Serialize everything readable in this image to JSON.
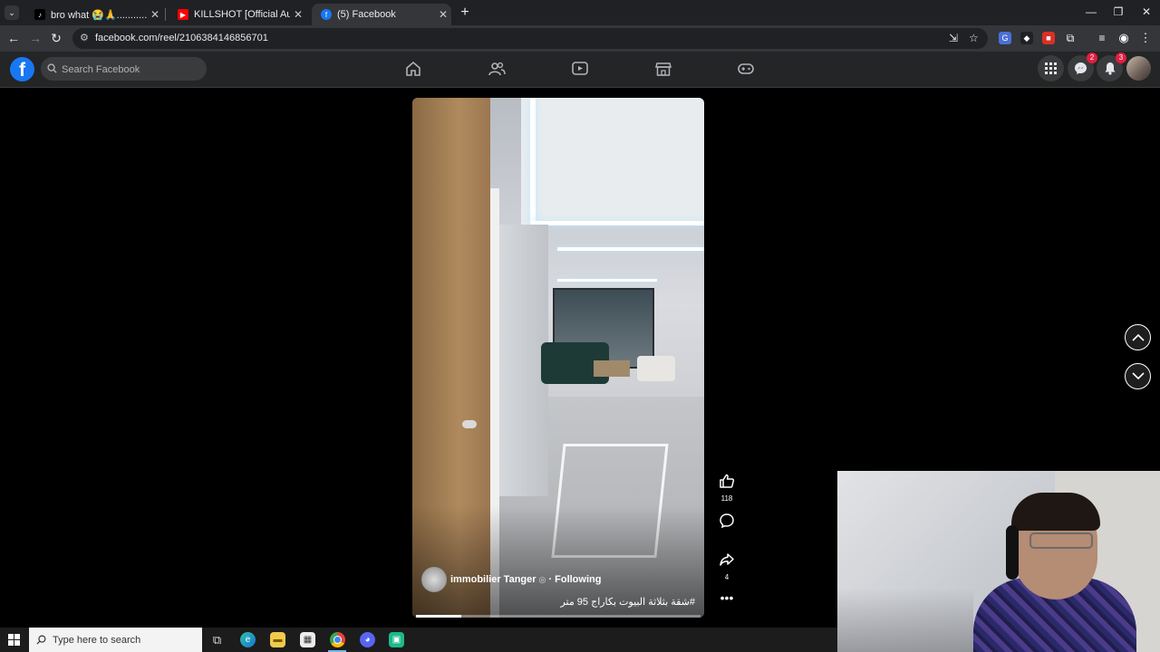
{
  "browser": {
    "tabs": [
      {
        "title": "bro what 😭🙏.....................#fy",
        "active": false,
        "favicon": "tiktok-icon"
      },
      {
        "title": "KILLSHOT [Official Audio] - You",
        "active": false,
        "favicon": "youtube-icon"
      },
      {
        "title": "(5) Facebook",
        "active": true,
        "favicon": "facebook-icon"
      }
    ],
    "url": "facebook.com/reel/2106384146856701"
  },
  "facebook": {
    "search_placeholder": "Search Facebook",
    "messenger_badge": "2",
    "notifications_badge": "3"
  },
  "reel": {
    "author": "immobilier Tanger",
    "following": "· Following",
    "caption": "#شقة بثلاثة البيوت بكاراج 95 متر",
    "likes": "118",
    "shares": "4",
    "progress": 0.16
  },
  "taskbar": {
    "search_placeholder": "Type here to search"
  },
  "colors": {
    "facebook_blue": "#1877f2",
    "badge_red": "#e41e3f",
    "page_bg": "#000000"
  }
}
